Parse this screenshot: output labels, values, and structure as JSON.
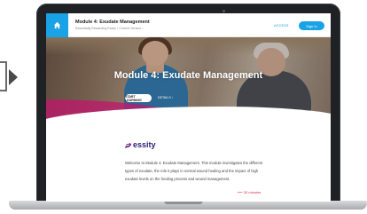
{
  "header": {
    "title": "Module 4: Exudate Management",
    "breadcrumb": "Essentially Rewarding Essity • Current Version ›",
    "link_label": "ACCESS",
    "button_label": "Sign In"
  },
  "hero": {
    "title": "Module 4: Exudate Management",
    "start_label": "START LEARNING",
    "details_label": "DETAILS ›"
  },
  "content": {
    "brand": "essity",
    "description": "Welcome to Module 4: Exudate Management. This module investigates the different types of exudate, the role it plays in normal wound healing and the impact of high exudate levels on the healing process and wound management.",
    "duration": "⟵ 30 minutes"
  },
  "colors": {
    "accent": "#1aa2e6",
    "brand": "#2b1e7a",
    "highlight": "#d62a40",
    "hero_wave": "#c2156d"
  },
  "icons": [
    "home-icon",
    "essity-logo-icon",
    "arrow-right-icon"
  ]
}
